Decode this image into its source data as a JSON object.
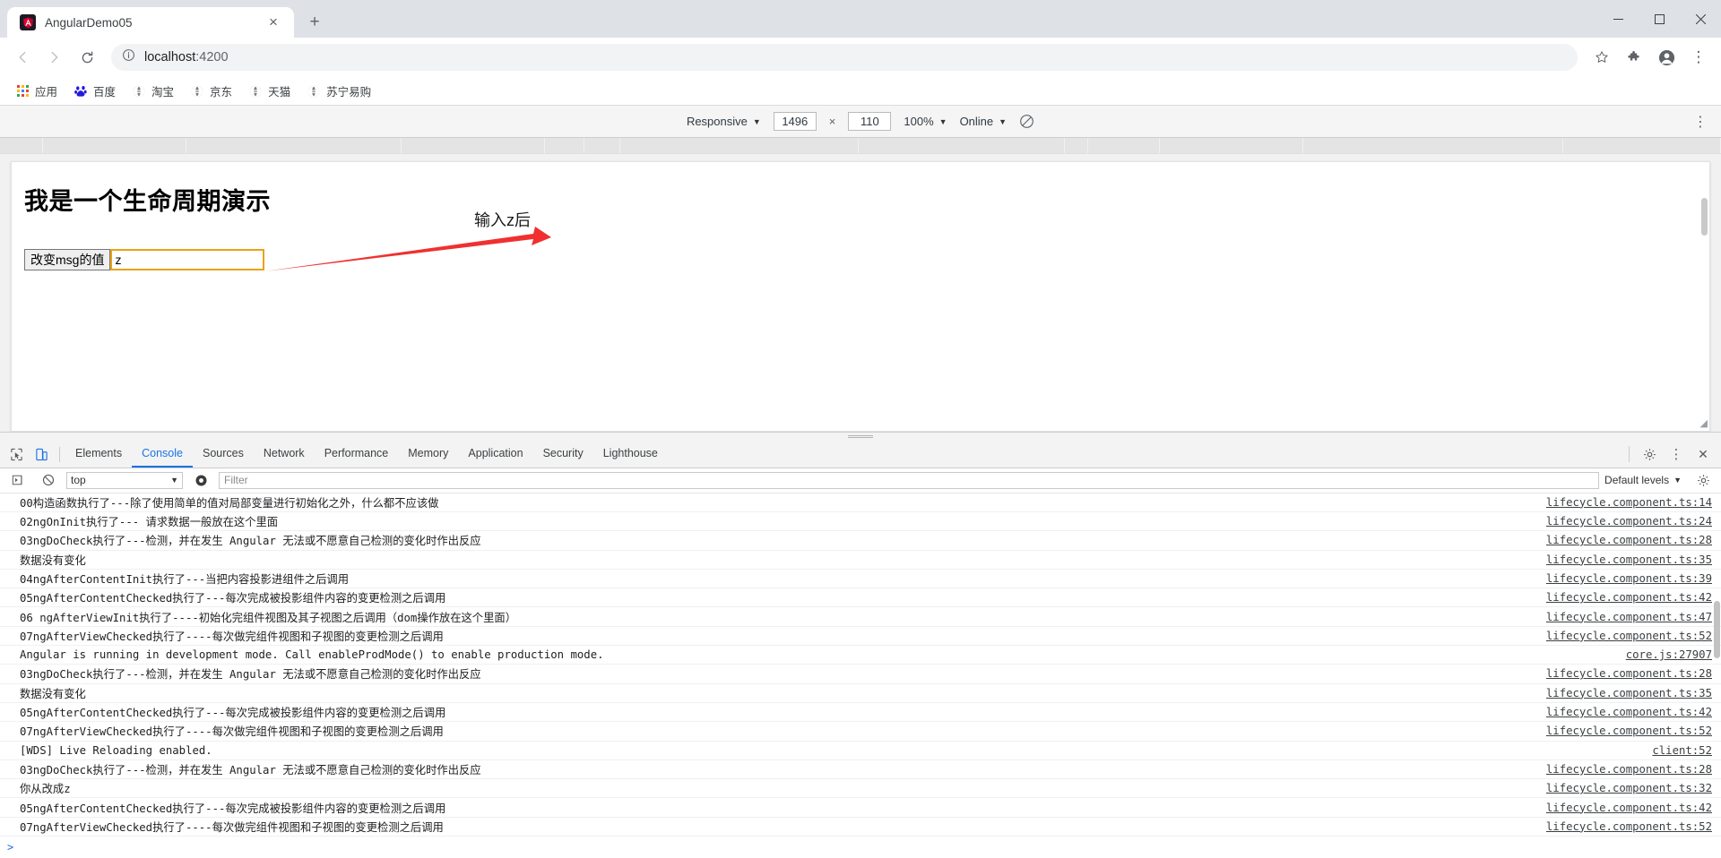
{
  "browser": {
    "tab": {
      "title": "AngularDemo05",
      "favicon": "angular-icon",
      "close_label": "×"
    },
    "new_tab_label": "+",
    "window_controls": {
      "minimize": "—",
      "maximize": "☐",
      "close": "✕"
    },
    "nav": {
      "back": "←",
      "forward": "→",
      "reload": "⟳"
    },
    "omnibox": {
      "info_icon": "info-circle-icon",
      "host": "localhost",
      "port": ":4200",
      "star": "☆"
    },
    "toolbar_icons": {
      "extensions": "puzzle-icon",
      "profile": "avatar-icon",
      "menu": "⋮"
    },
    "bookmarks": [
      {
        "label": "应用",
        "icon": "apps-grid-icon"
      },
      {
        "label": "百度",
        "icon": "baidu-icon"
      },
      {
        "label": "淘宝",
        "icon": "globe-icon"
      },
      {
        "label": "京东",
        "icon": "globe-icon"
      },
      {
        "label": "天猫",
        "icon": "globe-icon"
      },
      {
        "label": "苏宁易购",
        "icon": "globe-icon"
      }
    ]
  },
  "device_toolbar": {
    "device": "Responsive",
    "width": "1496",
    "height": "110",
    "x_symbol": "×",
    "zoom": "100%",
    "throttling": "Online",
    "rotate_icon": "rotate-icon",
    "more_icon": "⋮"
  },
  "page": {
    "heading": "我是一个生命周期演示",
    "button_label": "改变msg的值",
    "input_value": "z",
    "input_placeholder": "",
    "annotation": "输入z后",
    "annotation_color": "#f03030"
  },
  "devtools": {
    "tabs": [
      {
        "label": "Elements",
        "active": false
      },
      {
        "label": "Console",
        "active": true
      },
      {
        "label": "Sources",
        "active": false
      },
      {
        "label": "Network",
        "active": false
      },
      {
        "label": "Performance",
        "active": false
      },
      {
        "label": "Memory",
        "active": false
      },
      {
        "label": "Application",
        "active": false
      },
      {
        "label": "Security",
        "active": false
      },
      {
        "label": "Lighthouse",
        "active": false
      }
    ],
    "inspect_icon": "inspect-cursor-icon",
    "device_icon": "device-toggle-icon",
    "settings_icon": "gear-icon",
    "more_icon": "⋮",
    "close_icon": "✕",
    "filterbar": {
      "execute_icon": "execution-context-icon",
      "clear_icon": "clear-console-icon",
      "context": "top",
      "eye_icon": "live-expression-icon",
      "filter_placeholder": "Filter",
      "levels": "Default levels",
      "levels_settings_icon": "console-settings-icon"
    },
    "prompt": ">",
    "messages": [
      {
        "text": "00构造函数执行了---除了使用简单的值对局部变量进行初始化之外，什么都不应该做",
        "source": "lifecycle.component.ts:14"
      },
      {
        "text": "02ngOnInit执行了--- 请求数据一般放在这个里面",
        "source": "lifecycle.component.ts:24"
      },
      {
        "text": "03ngDoCheck执行了---检测，并在发生 Angular 无法或不愿意自己检测的变化时作出反应",
        "source": "lifecycle.component.ts:28"
      },
      {
        "text": "数据没有变化",
        "source": "lifecycle.component.ts:35"
      },
      {
        "text": "04ngAfterContentInit执行了---当把内容投影进组件之后调用",
        "source": "lifecycle.component.ts:39"
      },
      {
        "text": "05ngAfterContentChecked执行了---每次完成被投影组件内容的变更检测之后调用",
        "source": "lifecycle.component.ts:42"
      },
      {
        "text": "06 ngAfterViewInit执行了----初始化完组件视图及其子视图之后调用（dom操作放在这个里面）",
        "source": "lifecycle.component.ts:47"
      },
      {
        "text": "07ngAfterViewChecked执行了----每次做完组件视图和子视图的变更检测之后调用",
        "source": "lifecycle.component.ts:52"
      },
      {
        "text": "Angular is running in development mode. Call enableProdMode() to enable production mode.",
        "source": "core.js:27907"
      },
      {
        "text": "03ngDoCheck执行了---检测，并在发生 Angular 无法或不愿意自己检测的变化时作出反应",
        "source": "lifecycle.component.ts:28"
      },
      {
        "text": "数据没有变化",
        "source": "lifecycle.component.ts:35"
      },
      {
        "text": "05ngAfterContentChecked执行了---每次完成被投影组件内容的变更检测之后调用",
        "source": "lifecycle.component.ts:42"
      },
      {
        "text": "07ngAfterViewChecked执行了----每次做完组件视图和子视图的变更检测之后调用",
        "source": "lifecycle.component.ts:52"
      },
      {
        "text": "[WDS] Live Reloading enabled.",
        "source": "client:52"
      },
      {
        "text": "03ngDoCheck执行了---检测，并在发生 Angular 无法或不愿意自己检测的变化时作出反应",
        "source": "lifecycle.component.ts:28"
      },
      {
        "text": "你从改成z",
        "source": "lifecycle.component.ts:32"
      },
      {
        "text": "05ngAfterContentChecked执行了---每次完成被投影组件内容的变更检测之后调用",
        "source": "lifecycle.component.ts:42"
      },
      {
        "text": "07ngAfterViewChecked执行了----每次做完组件视图和子视图的变更检测之后调用",
        "source": "lifecycle.component.ts:52"
      }
    ]
  },
  "colors": {
    "accent": "#1a73e8",
    "link": "#3c4043",
    "input_focus": "#e8a317",
    "arrow": "#f03030"
  }
}
